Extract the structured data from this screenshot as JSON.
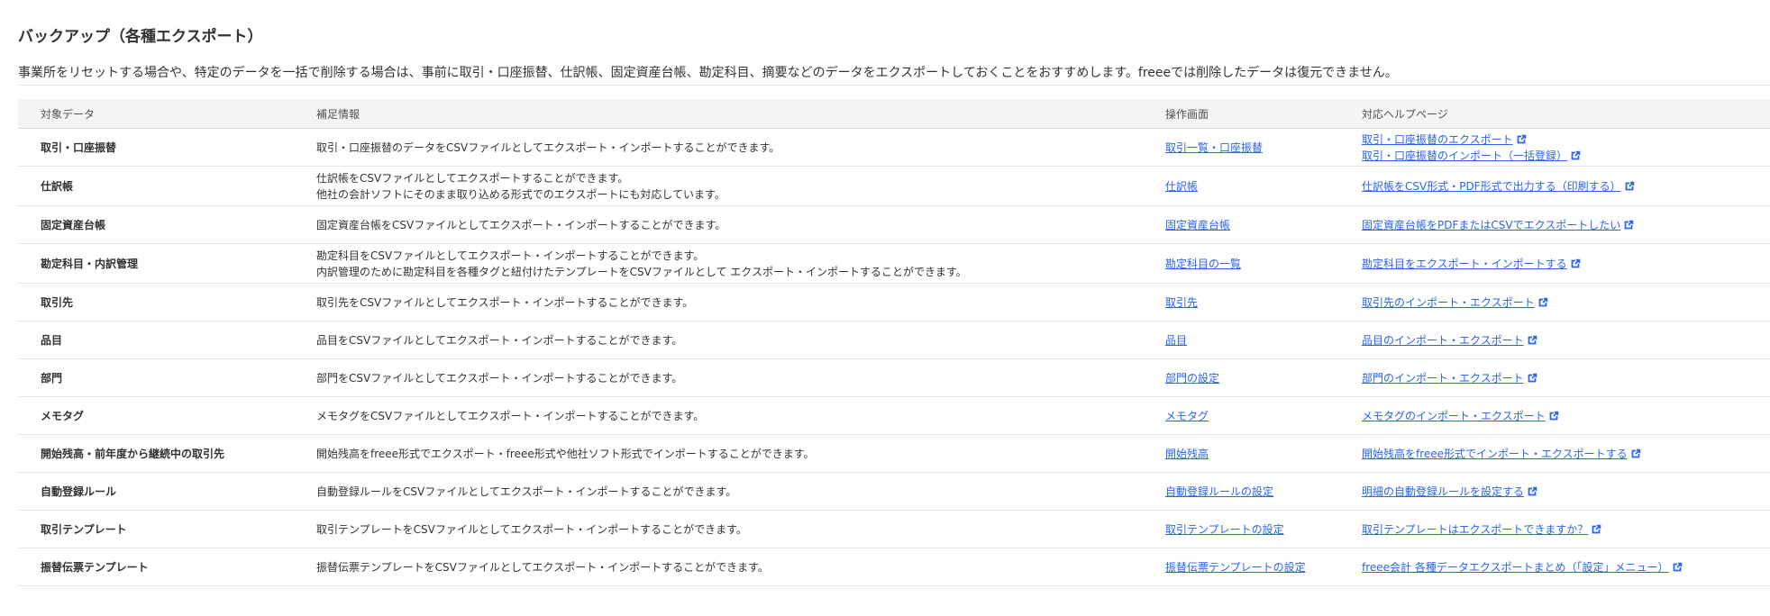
{
  "title": "バックアップ（各種エクスポート）",
  "description": "事業所をリセットする場合や、特定のデータを一括で削除する場合は、事前に取引・口座振替、仕訳帳、固定資産台帳、勘定科目、摘要などのデータをエクスポートしておくことをおすすめします。freeeでは削除したデータは復元できません。",
  "colors": {
    "link": "#2864f0",
    "header_bg": "#f5f4f3",
    "text": "#323232",
    "border": "#e6e6e6"
  },
  "table": {
    "headers": {
      "target": "対象データ",
      "info": "補足情報",
      "screen": "操作画面",
      "help": "対応ヘルプページ"
    },
    "rows": [
      {
        "target": "取引・口座振替",
        "info": [
          "取引・口座振替のデータをCSVファイルとしてエクスポート・インポートすることができます。"
        ],
        "screen": "取引一覧・口座振替",
        "help": [
          "取引・口座振替のエクスポート",
          "取引・口座振替のインポート（一括登録）"
        ]
      },
      {
        "target": "仕訳帳",
        "info": [
          "仕訳帳をCSVファイルとしてエクスポートすることができます。",
          "他社の会計ソフトにそのまま取り込める形式でのエクスポートにも対応しています。"
        ],
        "screen": "仕訳帳",
        "help": [
          "仕訳帳をCSV形式・PDF形式で出力する（印刷する）"
        ]
      },
      {
        "target": "固定資産台帳",
        "info": [
          "固定資産台帳をCSVファイルとしてエクスポート・インポートすることができます。"
        ],
        "screen": "固定資産台帳",
        "help": [
          "固定資産台帳をPDFまたはCSVでエクスポートしたい"
        ]
      },
      {
        "target": "勘定科目・内訳管理",
        "info": [
          "勘定科目をCSVファイルとしてエクスポート・インポートすることができます。",
          "内訳管理のために勘定科目を各種タグと紐付けたテンプレートをCSVファイルとして エクスポート・インポートすることができます。"
        ],
        "screen": "勘定科目の一覧",
        "help": [
          "勘定科目をエクスポート・インポートする"
        ]
      },
      {
        "target": "取引先",
        "info": [
          "取引先をCSVファイルとしてエクスポート・インポートすることができます。"
        ],
        "screen": "取引先",
        "help": [
          "取引先のインポート・エクスポート"
        ]
      },
      {
        "target": "品目",
        "info": [
          "品目をCSVファイルとしてエクスポート・インポートすることができます。"
        ],
        "screen": "品目",
        "help": [
          "品目のインポート・エクスポート"
        ]
      },
      {
        "target": "部門",
        "info": [
          "部門をCSVファイルとしてエクスポート・インポートすることができます。"
        ],
        "screen": "部門の設定",
        "help": [
          "部門のインポート・エクスポート"
        ]
      },
      {
        "target": "メモタグ",
        "info": [
          "メモタグをCSVファイルとしてエクスポート・インポートすることができます。"
        ],
        "screen": "メモタグ",
        "help": [
          "メモタグのインポート・エクスポート"
        ]
      },
      {
        "target": "開始残高・前年度から継続中の取引先",
        "info": [
          "開始残高をfreee形式でエクスポート・freee形式や他社ソフト形式でインポートすることができます。"
        ],
        "screen": "開始残高",
        "help": [
          "開始残高をfreee形式でインポート・エクスポートする"
        ]
      },
      {
        "target": "自動登録ルール",
        "info": [
          "自動登録ルールをCSVファイルとしてエクスポート・インポートすることができます。"
        ],
        "screen": "自動登録ルールの設定",
        "help": [
          "明細の自動登録ルールを設定する"
        ]
      },
      {
        "target": "取引テンプレート",
        "info": [
          "取引テンプレートをCSVファイルとしてエクスポート・インポートすることができます。"
        ],
        "screen": "取引テンプレートの設定",
        "help": [
          "取引テンプレートはエクスポートできますか？"
        ]
      },
      {
        "target": "振替伝票テンプレート",
        "info": [
          "振替伝票テンプレートをCSVファイルとしてエクスポート・インポートすることができます。"
        ],
        "screen": "振替伝票テンプレートの設定",
        "help": [
          "freee会計 各種データエクスポートまとめ（「設定」メニュー）"
        ]
      }
    ]
  }
}
